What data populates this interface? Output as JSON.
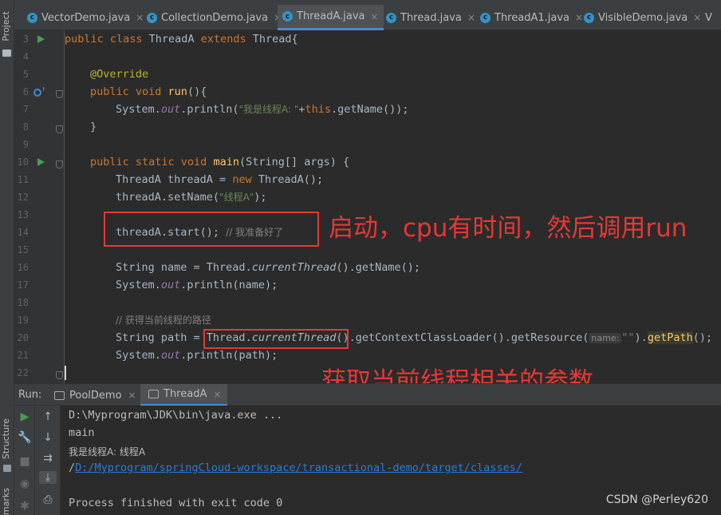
{
  "sidebar": {
    "project_label": "Project",
    "structure_label": "Structure",
    "bookmarks_label": "marks"
  },
  "tabs": [
    {
      "label": "VectorDemo.java"
    },
    {
      "label": "CollectionDemo.java"
    },
    {
      "label": "ThreadA.java"
    },
    {
      "label": "Thread.java"
    },
    {
      "label": "ThreadA1.java"
    },
    {
      "label": "VisibleDemo.java"
    },
    {
      "label": "V"
    }
  ],
  "editor": {
    "line_numbers": [
      "3",
      "4",
      "5",
      "6",
      "7",
      "8",
      "9",
      "10",
      "11",
      "12",
      "13",
      "14",
      "15",
      "16",
      "17",
      "18",
      "19",
      "20",
      "21",
      "22"
    ],
    "code": {
      "l3_a": "public class ",
      "l3_b": "ThreadA ",
      "l3_c": "extends ",
      "l3_d": "Thread{",
      "l5": "@Override",
      "l6_a": "public void ",
      "l6_b": "run",
      "l6_c": "(){",
      "l7_a": "System.",
      "l7_b": "out",
      "l7_c": ".println(",
      "l7_d": "\"我是线程A: \"",
      "l7_e": "+",
      "l7_f": "this",
      "l7_g": ".getName());",
      "l8": "}",
      "l10_a": "public static void ",
      "l10_b": "main",
      "l10_c": "(String[] args) {",
      "l11_a": "ThreadA threadA = ",
      "l11_b": "new ",
      "l11_c": "ThreadA();",
      "l12_a": "threadA.setName(",
      "l12_b": "\"线程A\"",
      "l12_c": ");",
      "l14_a": "threadA.start(); ",
      "l14_b": "// 我准备好了",
      "l16_a": "String name = Thread.",
      "l16_b": "currentThread",
      "l16_c": "().getName();",
      "l17_a": "System.",
      "l17_b": "out",
      "l17_c": ".println(name);",
      "l19": "// 获得当前线程的路径",
      "l20_a": "String path = ",
      "l20_b": "Thread.",
      "l20_c": "currentThread",
      "l20_d": "()",
      "l20_e": ".getContextClassLoader().getResource(",
      "l20_f": "name:",
      "l20_g": "\"\"",
      "l20_h": ").",
      "l20_i": "getPath",
      "l20_j": "();",
      "l21_a": "System.",
      "l21_b": "out",
      "l21_c": ".println(path);"
    },
    "annotation_start": "启动，cpu有时间，然后调用run",
    "annotation_params": "获取当前线程相关的参数"
  },
  "run_panel": {
    "run_label": "Run:",
    "tabs": [
      {
        "label": "PoolDemo"
      },
      {
        "label": "ThreadA"
      }
    ],
    "console": {
      "line1": "D:\\Myprogram\\JDK\\bin\\java.exe ...",
      "line2": "main",
      "line3": "我是线程A: 线程A",
      "line4_prefix": "/",
      "line4_link": "D:/Myprogram/springCloud-workspace/transactional-demo/target/classes/",
      "line5": "Process finished with exit code 0"
    }
  },
  "watermark": "CSDN @Perley620"
}
